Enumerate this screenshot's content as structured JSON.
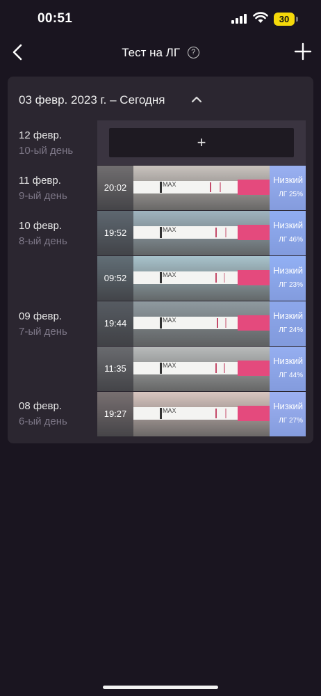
{
  "status_bar": {
    "time": "00:51",
    "battery": "30"
  },
  "nav": {
    "title": "Тест на ЛГ",
    "help_icon": "?"
  },
  "card": {
    "range_label": "03 февр. 2023 г. – Сегодня"
  },
  "add_button": {
    "label": "+"
  },
  "days": [
    {
      "date": "12 февр.",
      "day": "10-ый день"
    },
    {
      "date": "11 февр.",
      "day": "9-ый день"
    },
    {
      "date": "10 февр.",
      "day": "8-ый день"
    },
    {
      "date": "09 февр.",
      "day": "7-ый день"
    },
    {
      "date": "08 февр.",
      "day": "6-ый день"
    }
  ],
  "tests": [
    {
      "time": "20:02",
      "level": "Низкий",
      "lh": "ЛГ 25%",
      "photo_color": "#c9c3be"
    },
    {
      "time": "19:52",
      "level": "Низкий",
      "lh": "ЛГ 46%",
      "photo_color": "#9fb4bf"
    },
    {
      "time": "09:52",
      "level": "Низкий",
      "lh": "ЛГ 23%",
      "photo_color": "#a8c3cc"
    },
    {
      "time": "19:44",
      "level": "Низкий",
      "lh": "ЛГ 24%",
      "photo_color": "#8f9aa0"
    },
    {
      "time": "11:35",
      "level": "Низкий",
      "lh": "ЛГ 44%",
      "photo_color": "#b9bcbc"
    },
    {
      "time": "19:27",
      "level": "Низкий",
      "lh": "ЛГ 27%",
      "photo_color": "#d9c6c0"
    }
  ],
  "strip_text": "MAX",
  "colors": {
    "background": "#1a1520",
    "card": "#2b2630",
    "accent_result": "#8caaff",
    "strip_pink": "#e44a7d",
    "battery": "#f5d90a"
  }
}
